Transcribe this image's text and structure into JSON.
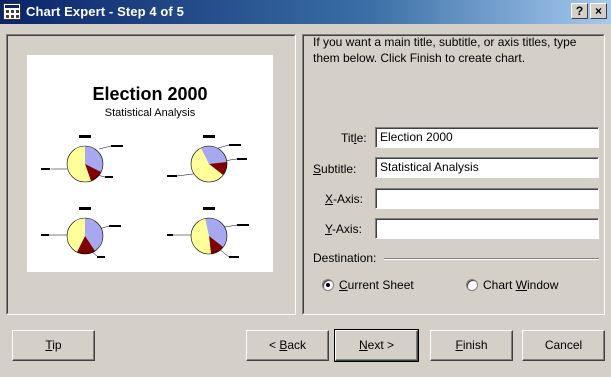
{
  "window": {
    "title": "Chart Expert - Step 4 of 5",
    "help_label": "?",
    "close_label": "×"
  },
  "preview": {
    "title": "Election 2000",
    "subtitle": "Statistical Analysis",
    "pie_colors": [
      "#a8a8f0",
      "#800000",
      "#ffff99"
    ]
  },
  "instructions": "If you want a main title, subtitle, or axis titles, type them below. Click Finish to create chart.",
  "fields": {
    "title": {
      "pre": "Tit",
      "key": "l",
      "post": "e:",
      "value": "Election 2000"
    },
    "subtitle": {
      "pre": "",
      "key": "S",
      "post": "ubtitle:",
      "value": "Statistical Analysis"
    },
    "x_axis": {
      "pre": "",
      "key": "X",
      "post": "-Axis:",
      "value": ""
    },
    "y_axis": {
      "pre": "",
      "key": "Y",
      "post": "-Axis:",
      "value": ""
    }
  },
  "destination": {
    "label": "Destination:",
    "current_sheet": {
      "pre": "",
      "key": "C",
      "post": "urrent Sheet",
      "selected": true
    },
    "chart_window": {
      "pre": "Chart ",
      "key": "W",
      "post": "indow",
      "selected": false
    }
  },
  "buttons": {
    "tip": {
      "pre": "",
      "key": "T",
      "post": "ip"
    },
    "back": {
      "pre": "< ",
      "key": "B",
      "post": "ack"
    },
    "next": {
      "pre": "",
      "key": "N",
      "post": "ext >"
    },
    "finish": {
      "pre": "",
      "key": "F",
      "post": "inish"
    },
    "cancel": {
      "pre": "",
      "key": "",
      "post": "Cancel"
    }
  }
}
